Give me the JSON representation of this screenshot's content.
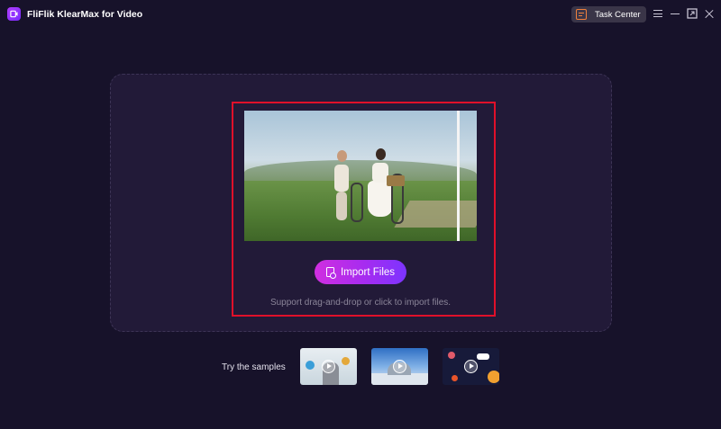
{
  "app": {
    "title": "FliFlik KlearMax for Video",
    "logo_icon": "play-logo-icon"
  },
  "header": {
    "task_center_label": "Task Center",
    "task_center_icon": "task-list-icon",
    "window_controls": [
      "menu-icon",
      "minimize-icon",
      "maximize-icon",
      "close-icon"
    ]
  },
  "dropzone": {
    "import_button_label": "Import Files",
    "import_icon": "import-file-icon",
    "hint": "Support drag-and-drop or click to import files.",
    "preview_icon": "before-after-preview"
  },
  "samples": {
    "label": "Try the samples",
    "items": [
      {
        "name": "sample-people",
        "icon": "play-icon"
      },
      {
        "name": "sample-winter-building",
        "icon": "play-icon"
      },
      {
        "name": "sample-space-cartoon",
        "icon": "play-icon"
      }
    ]
  },
  "colors": {
    "background": "#17122a",
    "dropzone": "#221a38",
    "accent_start": "#d02ee0",
    "accent_end": "#7c34ff",
    "highlight": "#e0102a",
    "task_icon": "#f0803c"
  }
}
